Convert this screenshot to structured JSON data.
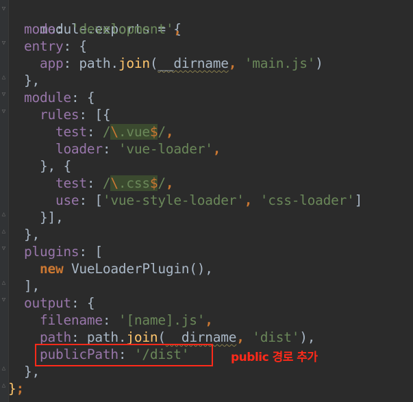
{
  "code": {
    "l1": [
      "module.exports = {"
    ],
    "l2": [
      "mode",
      ": ",
      "'development'",
      ","
    ],
    "l3": [
      "entry",
      ": {"
    ],
    "l4": [
      "app",
      ": path.",
      "join",
      "(",
      "__dirname",
      ", ",
      "'main.js'",
      ")"
    ],
    "l5": [
      "},"
    ],
    "l6": [
      "module",
      ": {"
    ],
    "l7": [
      "rules",
      ": [{"
    ],
    "l8": [
      "test",
      ": ",
      "/",
      "\\",
      ".vue",
      "$",
      "/",
      ","
    ],
    "l9": [
      "loader",
      ": ",
      "'vue-loader'",
      ","
    ],
    "l10": [
      "}, {"
    ],
    "l11": [
      "test",
      ": ",
      "/",
      "\\",
      ".css",
      "$",
      "/",
      ","
    ],
    "l12": [
      "use",
      ": [",
      "'vue-style-loader'",
      ", ",
      "'css-loader'",
      "]"
    ],
    "l13": [
      "}],"
    ],
    "l14": [
      "},"
    ],
    "l15": [
      "plugins",
      ": ["
    ],
    "l16": [
      "new",
      " VueLoaderPlugin",
      "(),"
    ],
    "l17": [
      "],"
    ],
    "l18": [
      "output",
      ": {"
    ],
    "l19": [
      "filename",
      ": ",
      "'[name].js'",
      ","
    ],
    "l20": [
      "path",
      ": path.",
      "join",
      "(",
      "__dirname",
      ", ",
      "'dist'",
      "),"
    ],
    "l21": [
      "publicPath",
      ": ",
      "'/dist'"
    ],
    "l22": [
      "},"
    ],
    "l23": [
      "}",
      ";"
    ]
  },
  "annotation": "public 경로 추가",
  "colors": {
    "keyword": "#cc7832",
    "property": "#9876aa",
    "string": "#6a8759",
    "function": "#ffc66d",
    "text": "#a9b7c6",
    "background": "#2b2b2b",
    "highlight": "#ff2a1a"
  }
}
